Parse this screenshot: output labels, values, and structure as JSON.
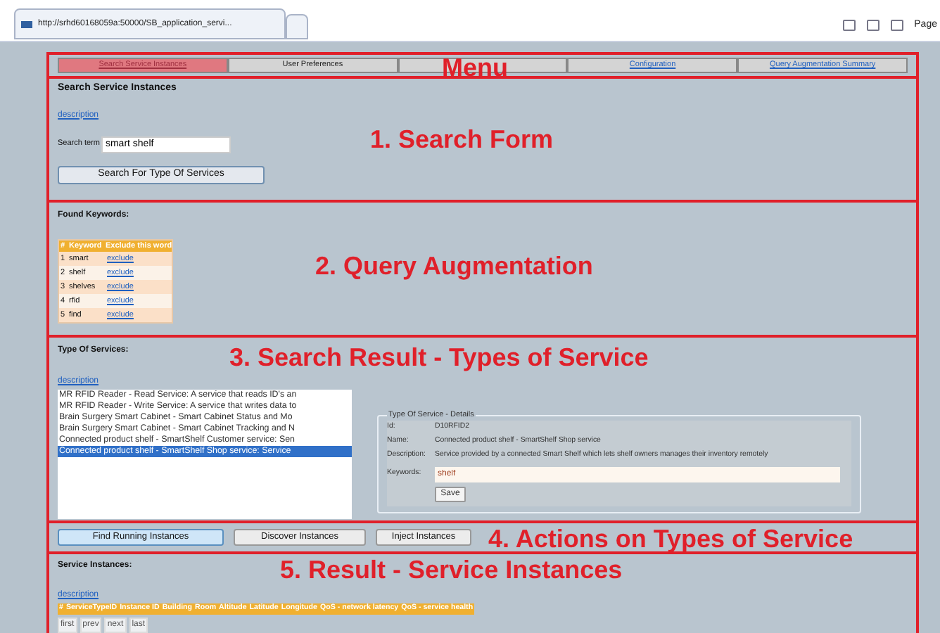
{
  "browser": {
    "tab_title": "http://srhd60168059a:50000/SB_application_servi...",
    "page_menu": "Page"
  },
  "menu": {
    "annotation": "Menu",
    "tabs": [
      {
        "label": "Search Service Instances",
        "selected": true
      },
      {
        "label": "User Preferences",
        "selected": false
      },
      {
        "selected": false
      },
      {
        "label": "Configuration",
        "selected": false
      },
      {
        "label": "Query Augmentation Summary",
        "selected": false
      }
    ]
  },
  "search_form": {
    "annotation": "1. Search Form",
    "title": "Search Service Instances",
    "description_link": "description",
    "search_label": "Search term",
    "search_value": "smart shelf",
    "button": "Search For Type Of Services"
  },
  "query_augmentation": {
    "annotation": "2. Query Augmentation",
    "title": "Found Keywords:",
    "columns": [
      "#",
      "Keyword",
      "Exclude this word"
    ],
    "rows": [
      {
        "number": "1",
        "keyword": "smart",
        "action": "exclude"
      },
      {
        "number": "2",
        "keyword": "shelf",
        "action": "exclude"
      },
      {
        "number": "3",
        "keyword": "shelves",
        "action": "exclude"
      },
      {
        "number": "4",
        "keyword": "rfid",
        "action": "exclude"
      },
      {
        "number": "5",
        "keyword": "find",
        "action": "exclude"
      }
    ]
  },
  "types_of_service": {
    "annotation": "3. Search Result - Types of Service",
    "title": "Type Of Services:",
    "description_link": "description",
    "items": [
      {
        "label": "MR RFID Reader - Read Service: A service that reads ID's an",
        "selected": false
      },
      {
        "label": "MR RFID Reader - Write Service: A service that writes data to",
        "selected": false
      },
      {
        "label": "Brain Surgery Smart Cabinet - Smart Cabinet Status and Mo",
        "selected": false
      },
      {
        "label": "Brain Surgery Smart Cabinet - Smart Cabinet Tracking and N",
        "selected": false
      },
      {
        "label": "Connected product shelf - SmartShelf Customer service: Sen",
        "selected": false
      },
      {
        "label": "Connected product shelf - SmartShelf Shop service: Service",
        "selected": true
      }
    ],
    "details": {
      "legend": "Type Of Service - Details",
      "fields": [
        {
          "label": "Id:",
          "value": "D10RFID2"
        },
        {
          "label": "Name:",
          "value": "Connected product shelf - SmartShelf Shop service"
        },
        {
          "label": "Description:",
          "value": "Service provided by a connected Smart Shelf which lets shelf owners manages their inventory remotely"
        }
      ],
      "keywords_label": "Keywords:",
      "keywords_value": "shelf",
      "save_button": "Save"
    }
  },
  "actions": {
    "annotation": "4. Actions on Types of Service",
    "buttons": [
      {
        "label": "Find Running Instances",
        "selected": true
      },
      {
        "label": "Discover Instances",
        "selected": false
      },
      {
        "label": "Inject Instances",
        "selected": false
      }
    ]
  },
  "service_instances": {
    "annotation": "5. Result - Service Instances",
    "title": "Service Instances:",
    "description_link": "description",
    "columns": [
      "#",
      "ServiceTypeID",
      "Instance ID",
      "Building",
      "Room",
      "Altitude",
      "Latitude",
      "Longitude",
      "QoS - network latency",
      "QoS - service health"
    ],
    "pager": [
      "first",
      "prev",
      "next",
      "last"
    ]
  }
}
